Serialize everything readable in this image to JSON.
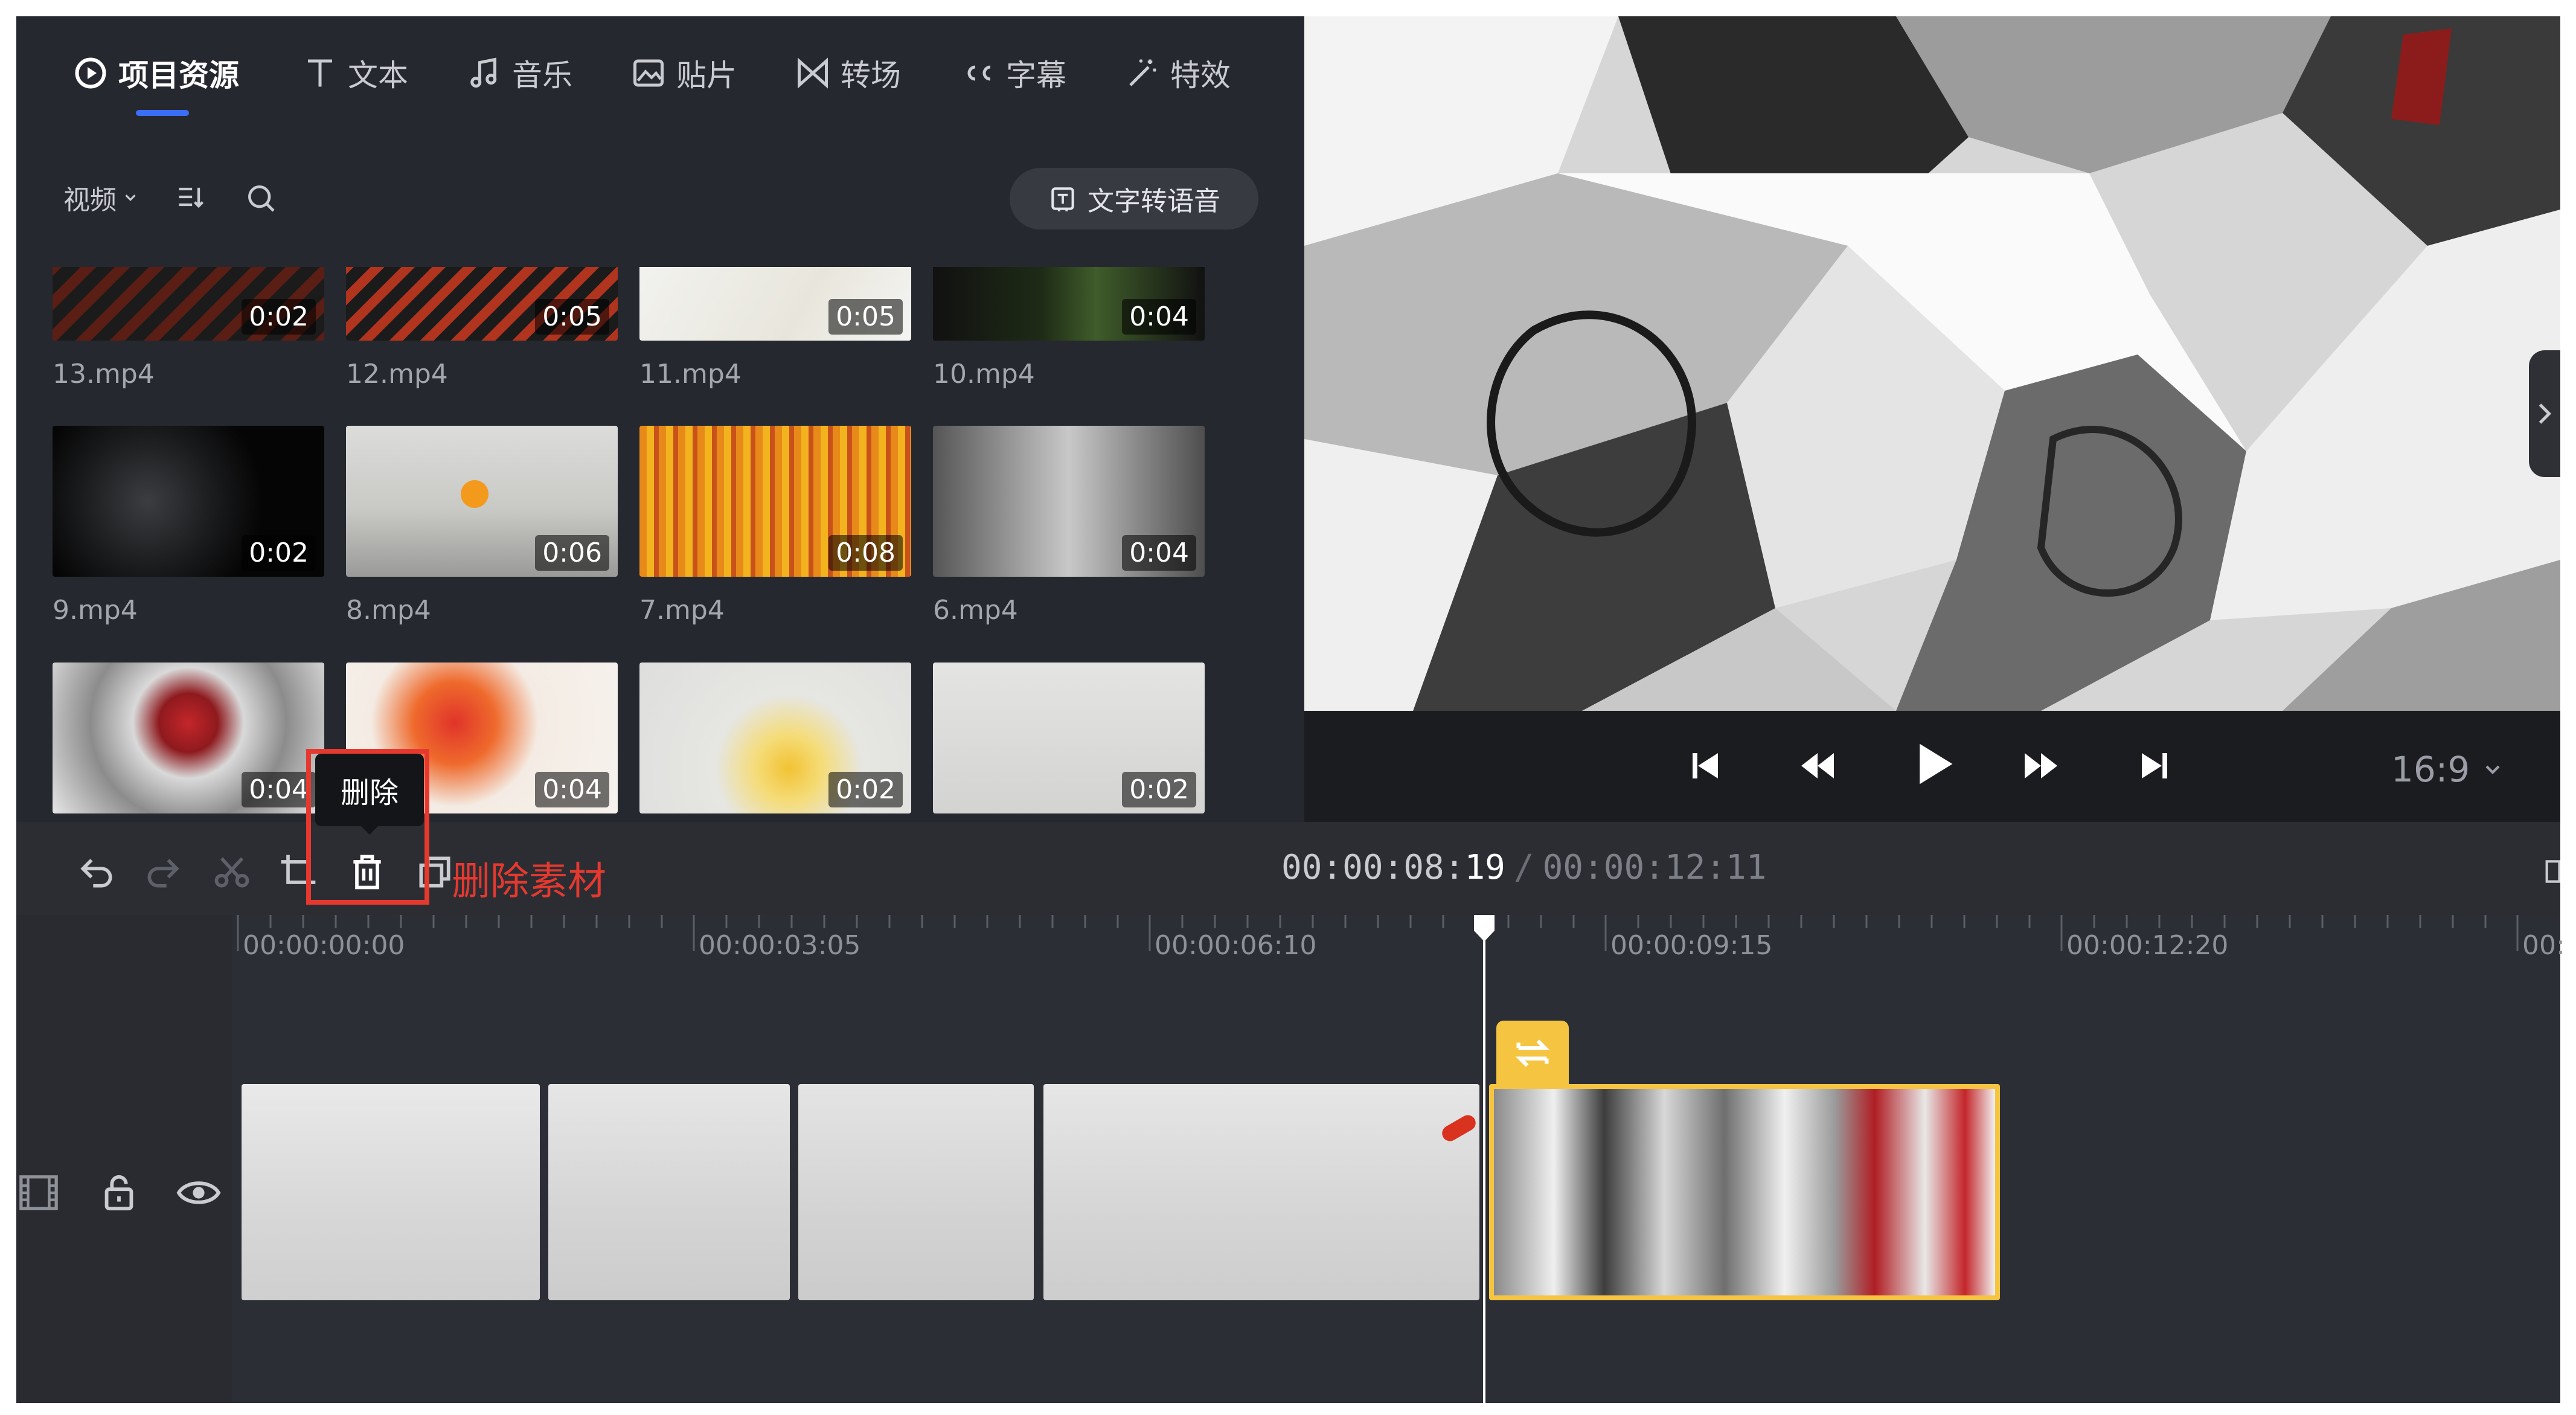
{
  "tabs": [
    {
      "label": "项目资源",
      "icon": "play-circle-icon",
      "active": true
    },
    {
      "label": "文本",
      "icon": "text-icon"
    },
    {
      "label": "音乐",
      "icon": "music-note-icon"
    },
    {
      "label": "贴片",
      "icon": "image-icon"
    },
    {
      "label": "转场",
      "icon": "transition-icon"
    },
    {
      "label": "字幕",
      "icon": "caption-icon"
    },
    {
      "label": "特效",
      "icon": "magic-wand-icon"
    }
  ],
  "filter": {
    "type_label": "视频",
    "tts_label": "文字转语音"
  },
  "media": [
    {
      "name": "13.mp4",
      "duration": "0:02"
    },
    {
      "name": "12.mp4",
      "duration": "0:05"
    },
    {
      "name": "11.mp4",
      "duration": "0:05"
    },
    {
      "name": "10.mp4",
      "duration": "0:04"
    },
    {
      "name": "9.mp4",
      "duration": "0:02"
    },
    {
      "name": "8.mp4",
      "duration": "0:06"
    },
    {
      "name": "7.mp4",
      "duration": "0:08"
    },
    {
      "name": "6.mp4",
      "duration": "0:04"
    },
    {
      "name": "",
      "duration": "0:04"
    },
    {
      "name": "",
      "duration": "0:04"
    },
    {
      "name": "",
      "duration": "0:02"
    },
    {
      "name": "",
      "duration": "0:02"
    }
  ],
  "player": {
    "aspect_ratio": "16:9"
  },
  "toolbar": {
    "tooltip": "删除",
    "annotation": "删除素材",
    "current_time": "00:00:08:",
    "current_frame": "19",
    "separator": "/",
    "total_time": "00:00:12:11"
  },
  "ruler": {
    "ticks": [
      "00:00:00:00",
      "00:00:03:05",
      "00:00:06:10",
      "00:00:09:15",
      "00:00:12:20",
      "00:"
    ]
  },
  "colors": {
    "accent": "#3b6ef6",
    "highlight": "#e5392f",
    "selected_clip": "#f5c542"
  }
}
